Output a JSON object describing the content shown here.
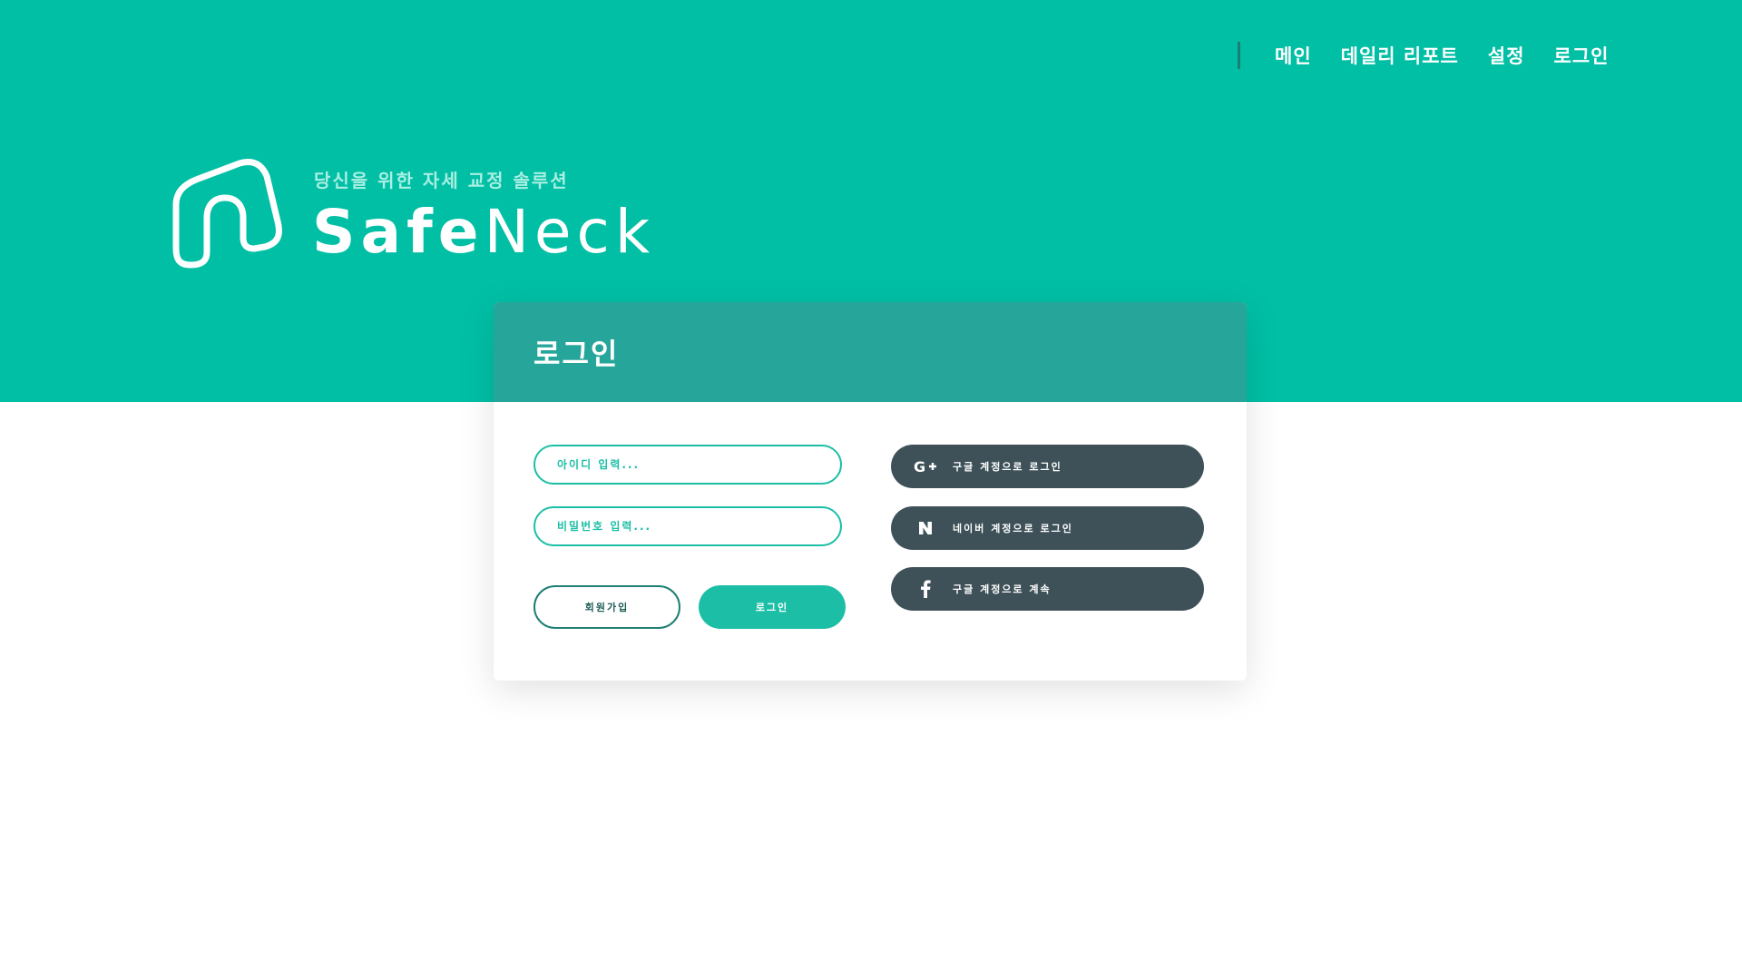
{
  "nav": {
    "items": [
      "메인",
      "데일리 리포트",
      "설정",
      "로그인"
    ]
  },
  "brand": {
    "tagline": "당신을 위한 자세 교정 솔루션",
    "name_bold": "Safe",
    "name_light": "Neck"
  },
  "login": {
    "title": "로그인",
    "id_placeholder": "아이디 입력...",
    "pw_placeholder": "비밀번호 입력...",
    "signup_label": "회원가입",
    "login_label": "로그인",
    "social": [
      {
        "icon": "google-plus-icon",
        "label": "구글 계정으로 로그인"
      },
      {
        "icon": "naver-icon",
        "label": "네이버 계정으로 로그인"
      },
      {
        "icon": "facebook-icon",
        "label": "구글 계정으로 계속"
      }
    ]
  },
  "colors": {
    "primary": "#00bfa5",
    "header": "#26a69a",
    "dark_button": "#3e5159",
    "accent_text": "#1cbfa6"
  }
}
